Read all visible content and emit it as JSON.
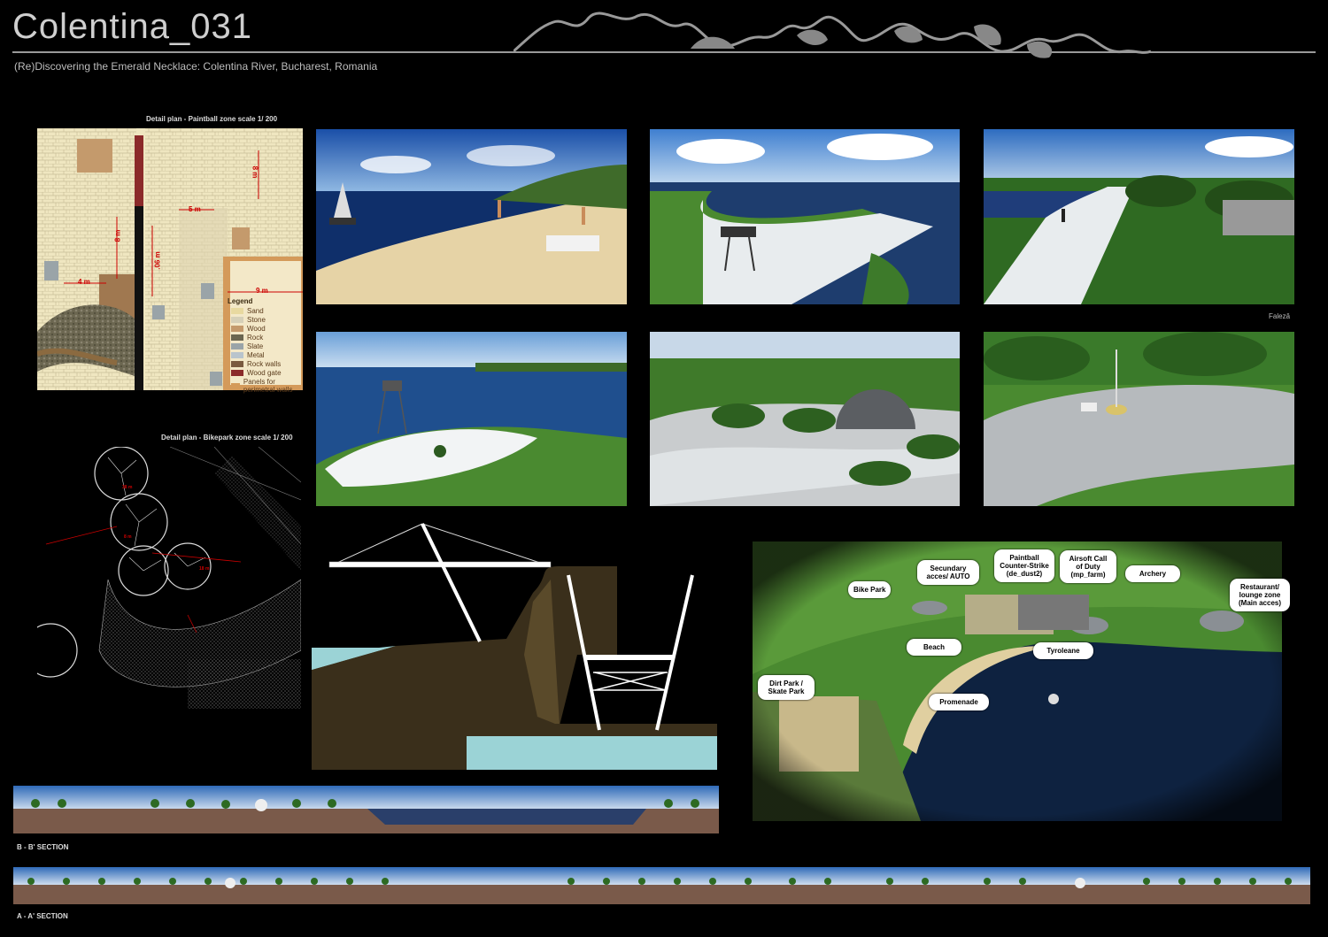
{
  "header": {
    "title": "Colentina_031",
    "subtitle": "(Re)Discovering the Emerald Necklace: Colentina River, Bucharest, Romania"
  },
  "paintball_plan": {
    "caption": "Detail plan - Paintball zone scale 1/ 200",
    "dimensions": [
      "4 m",
      "8 m",
      "5 m",
      "8 m",
      "9 m",
      ".06 m"
    ],
    "legend_title": "Legend",
    "legend": [
      {
        "label": "Sand",
        "color": "#e8d9a0"
      },
      {
        "label": "Stone",
        "color": "#d6d0b8"
      },
      {
        "label": "Wood",
        "color": "#c49a6c"
      },
      {
        "label": "Rock",
        "color": "#6b6650"
      },
      {
        "label": "Slate",
        "color": "#9aa4a8"
      },
      {
        "label": "Metal",
        "color": "#b9c4cc"
      },
      {
        "label": "Rock walls",
        "color": "#7a5a40"
      },
      {
        "label": "Wood gate",
        "color": "#8b2a2a"
      },
      {
        "label": "Panels for perimetral walls",
        "color": "#d49a5a"
      }
    ]
  },
  "bikepark_plan": {
    "caption": "Detail plan - Bikepark zone scale 1/ 200",
    "dimensions": [
      "38 m",
      "8 m",
      "18 m"
    ]
  },
  "renders": {
    "faleza_label": "Falezǎ"
  },
  "masterplan": {
    "labels": [
      "Bike Park",
      "Secundary acces/ AUTO",
      "Paintball Counter-Strike (de_dust2)",
      "Airsoft Call of Duty (mp_farm)",
      "Archery",
      "Restaurant/ lounge zone (Main acces)",
      "Beach",
      "Tyroleane",
      "Dirt Park / Skate Park",
      "Promenade"
    ]
  },
  "sections": {
    "bb_label": "B - B' SECTION",
    "aa_label": "A - A' SECTION"
  }
}
